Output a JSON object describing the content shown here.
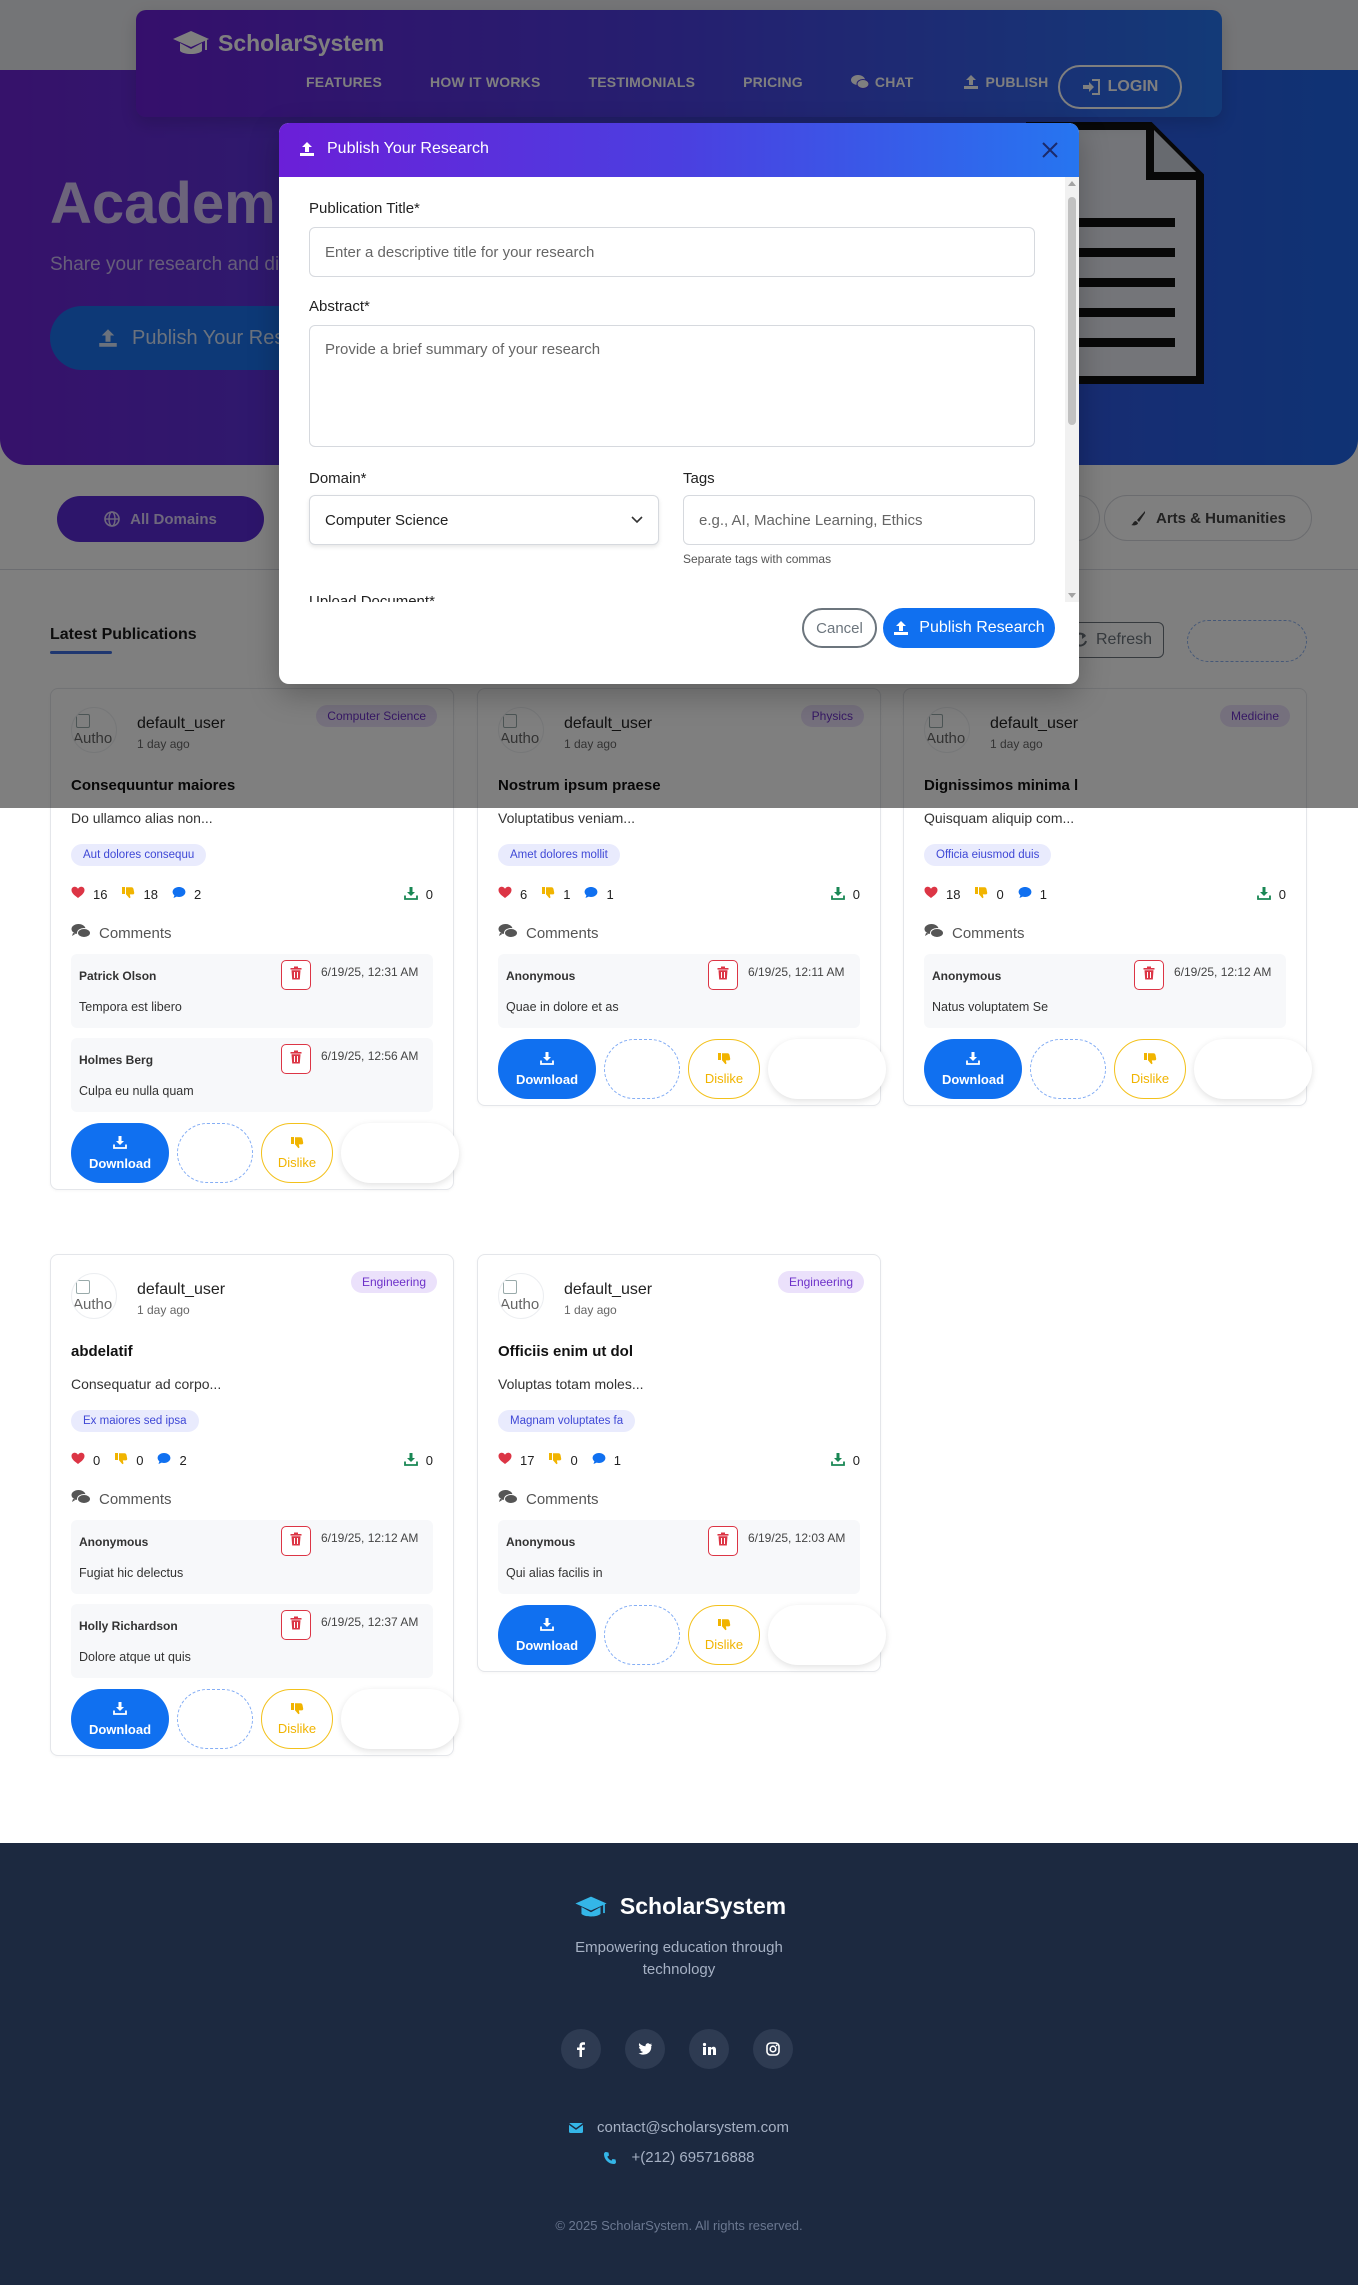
{
  "brand": {
    "name": "ScholarSystem"
  },
  "nav": {
    "links": [
      "FEATURES",
      "HOW IT WORKS",
      "TESTIMONIALS",
      "PRICING",
      "CHAT",
      "PUBLISH"
    ],
    "login": "LOGIN"
  },
  "hero": {
    "title": "Academi",
    "subtitle": "Share your research and dis",
    "button": "Publish Your Res"
  },
  "filters": {
    "all": "All Domains",
    "arts": "Arts & Humanities"
  },
  "section": {
    "title": "Latest Publications",
    "refresh": "Refresh"
  },
  "modal": {
    "title": "Publish Your Research",
    "fields": {
      "title_label": "Publication Title*",
      "title_placeholder": "Enter a descriptive title for your research",
      "abstract_label": "Abstract*",
      "abstract_placeholder": "Provide a brief summary of your research",
      "domain_label": "Domain*",
      "domain_value": "Computer Science",
      "tags_label": "Tags",
      "tags_placeholder": "e.g., AI, Machine Learning, Ethics",
      "tags_hint": "Separate tags with commas",
      "upload_label": "Upload Document*"
    },
    "cancel": "Cancel",
    "submit": "Publish Research"
  },
  "avatar_alt": "Autho",
  "comments_label": "Comments",
  "download_label": "Download",
  "dislike_label": "Dislike",
  "publications": [
    {
      "user": "default_user",
      "time": "1 day ago",
      "domain": "Computer Science",
      "title": "Consequuntur maiores",
      "abstract": "Do ullamco alias non...",
      "tag": "Aut dolores consequu",
      "likes": "16",
      "dislikes": "18",
      "comments_count": "2",
      "downloads": "0",
      "comments": [
        {
          "author": "Patrick Olson",
          "date": "6/19/25, 12:31 AM",
          "text": "Tempora est libero"
        },
        {
          "author": "Holmes Berg",
          "date": "6/19/25, 12:56 AM",
          "text": "Culpa eu nulla quam"
        }
      ]
    },
    {
      "user": "default_user",
      "time": "1 day ago",
      "domain": "Physics",
      "title": "Nostrum ipsum praese",
      "abstract": "Voluptatibus veniam...",
      "tag": "Amet dolores mollit",
      "likes": "6",
      "dislikes": "1",
      "comments_count": "1",
      "downloads": "0",
      "comments": [
        {
          "author": "Anonymous",
          "date": "6/19/25, 12:11 AM",
          "text": "Quae in dolore et as"
        }
      ]
    },
    {
      "user": "default_user",
      "time": "1 day ago",
      "domain": "Medicine",
      "title": "Dignissimos minima l",
      "abstract": "Quisquam aliquip com...",
      "tag": "Officia eiusmod duis",
      "likes": "18",
      "dislikes": "0",
      "comments_count": "1",
      "downloads": "0",
      "comments": [
        {
          "author": "Anonymous",
          "date": "6/19/25, 12:12 AM",
          "text": "Natus voluptatem Se"
        }
      ]
    },
    {
      "user": "default_user",
      "time": "1 day ago",
      "domain": "Engineering",
      "title": "abdelatif",
      "abstract": "Consequatur ad corpo...",
      "tag": "Ex maiores sed ipsa",
      "likes": "0",
      "dislikes": "0",
      "comments_count": "2",
      "downloads": "0",
      "comments": [
        {
          "author": "Anonymous",
          "date": "6/19/25, 12:12 AM",
          "text": "Fugiat hic delectus"
        },
        {
          "author": "Holly Richardson",
          "date": "6/19/25, 12:37 AM",
          "text": "Dolore atque ut quis"
        }
      ]
    },
    {
      "user": "default_user",
      "time": "1 day ago",
      "domain": "Engineering",
      "title": "Officiis enim ut dol",
      "abstract": "Voluptas totam moles...",
      "tag": "Magnam voluptates fa",
      "likes": "17",
      "dislikes": "0",
      "comments_count": "1",
      "downloads": "0",
      "comments": [
        {
          "author": "Anonymous",
          "date": "6/19/25, 12:03 AM",
          "text": "Qui alias facilis in"
        }
      ]
    }
  ],
  "footer": {
    "brand": "ScholarSystem",
    "tagline": "Empowering education through technology",
    "socials": [
      "facebook-icon",
      "twitter-icon",
      "linkedin-icon",
      "instagram-icon"
    ],
    "email": "contact@scholarsystem.com",
    "phone": "+(212) 695716888",
    "copyright": "© 2025 ScholarSystem. All rights reserved."
  },
  "colors": {
    "primary": "#1070f0",
    "gradient_start": "#6b1fd8",
    "gradient_end": "#2675f0",
    "like": "#dc3545",
    "dislike": "#f1b400",
    "comment": "#1070f0",
    "download": "#198754",
    "footer_bg": "#1c2940"
  }
}
